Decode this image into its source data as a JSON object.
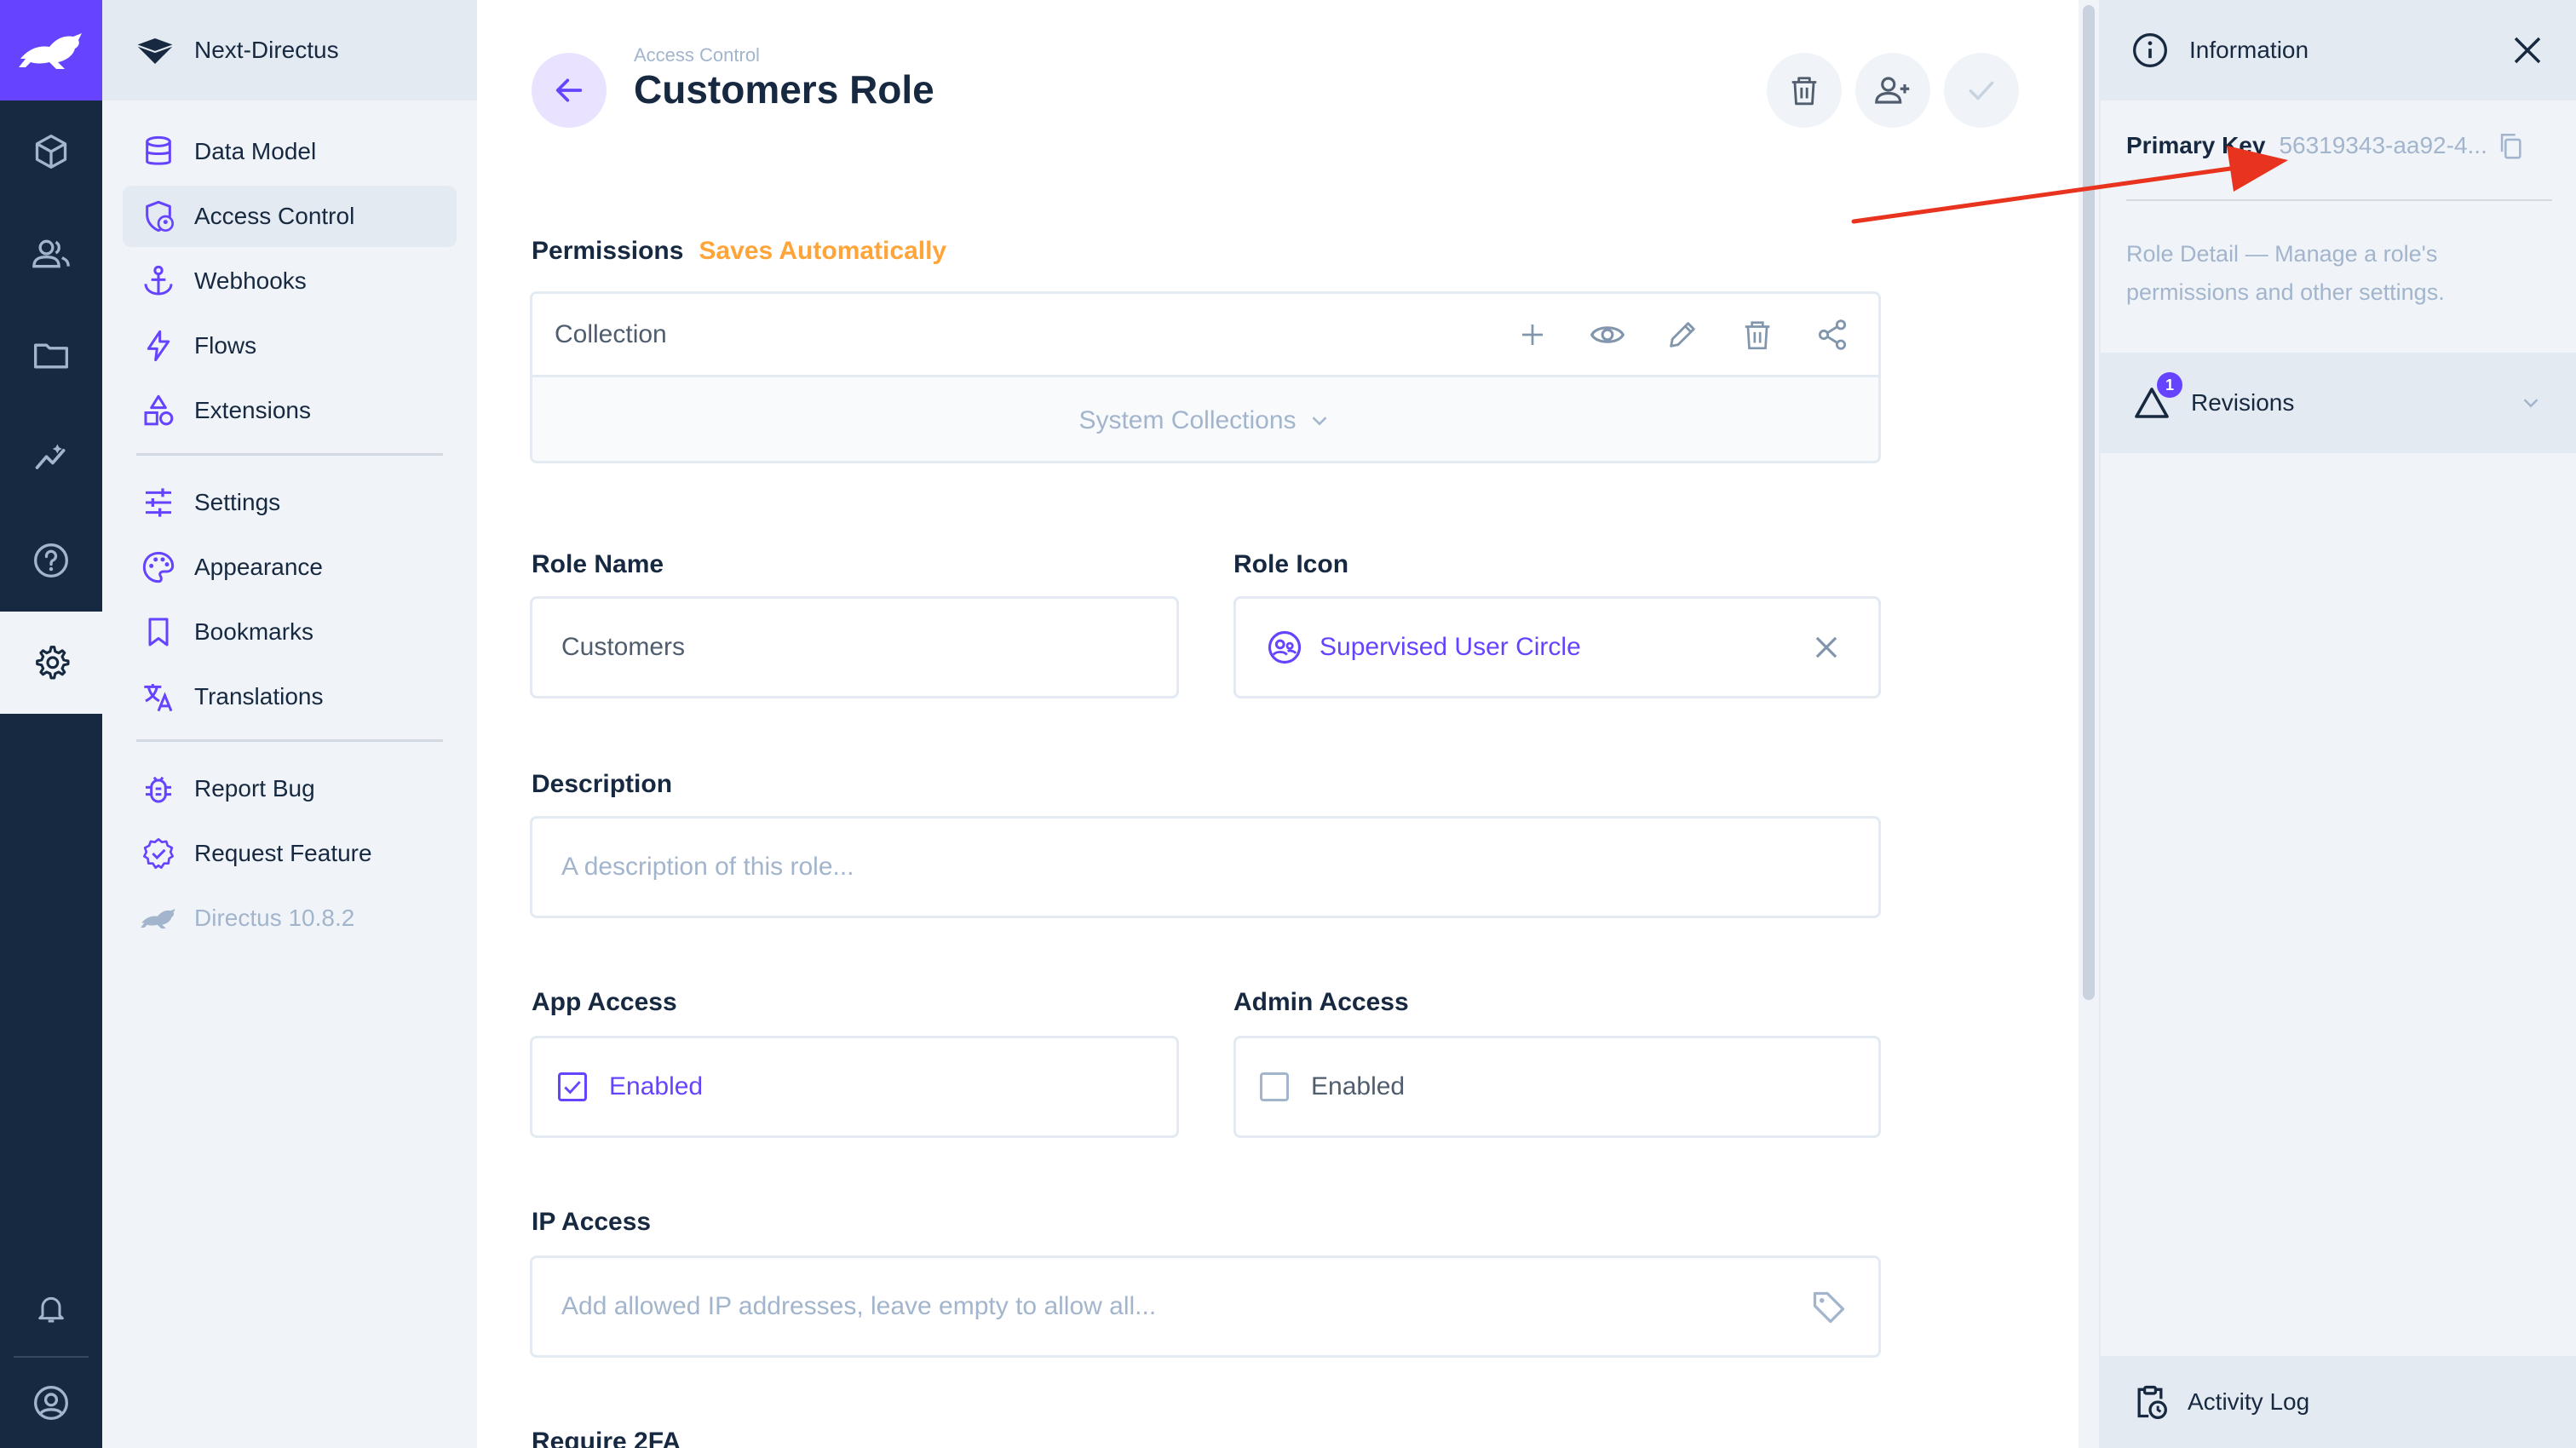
{
  "project": {
    "name": "Next-Directus"
  },
  "module_bar": {
    "items": [
      {
        "name": "content-module",
        "icon": "box-icon"
      },
      {
        "name": "users-module",
        "icon": "people-icon"
      },
      {
        "name": "files-module",
        "icon": "folder-icon"
      },
      {
        "name": "insights-module",
        "icon": "insights-icon"
      },
      {
        "name": "docs-module",
        "icon": "help-icon"
      },
      {
        "name": "settings-module",
        "icon": "gear-icon",
        "active": true
      }
    ],
    "bottom": [
      "bell-icon",
      "account-circle-icon"
    ]
  },
  "nav": {
    "items": [
      {
        "label": "Data Model",
        "icon": "database-icon"
      },
      {
        "label": "Access Control",
        "icon": "admin-shield-icon",
        "active": true
      },
      {
        "label": "Webhooks",
        "icon": "anchor-icon"
      },
      {
        "label": "Flows",
        "icon": "bolt-icon"
      },
      {
        "label": "Extensions",
        "icon": "category-icon"
      },
      {
        "label": "Settings",
        "icon": "tune-icon"
      },
      {
        "label": "Appearance",
        "icon": "palette-icon"
      },
      {
        "label": "Bookmarks",
        "icon": "bookmark-icon"
      },
      {
        "label": "Translations",
        "icon": "translate-icon"
      },
      {
        "label": "Report Bug",
        "icon": "bug-icon"
      },
      {
        "label": "Request Feature",
        "icon": "verified-icon"
      },
      {
        "label": "Directus 10.8.2",
        "icon": "directus-rabbit-icon"
      }
    ]
  },
  "header": {
    "breadcrumb": "Access Control",
    "title": "Customers Role",
    "actions": [
      "delete",
      "invite-user",
      "save"
    ]
  },
  "permissions": {
    "label": "Permissions",
    "note": "Saves Automatically",
    "column": "Collection",
    "system_collections": "System Collections"
  },
  "form": {
    "role_name": {
      "label": "Role Name",
      "value": "Customers"
    },
    "role_icon": {
      "label": "Role Icon",
      "value": "Supervised User Circle"
    },
    "description": {
      "label": "Description",
      "placeholder": "A description of this role..."
    },
    "app_access": {
      "label": "App Access",
      "option": "Enabled",
      "checked": true
    },
    "admin_access": {
      "label": "Admin Access",
      "option": "Enabled",
      "checked": false
    },
    "ip_access": {
      "label": "IP Access",
      "placeholder": "Add allowed IP addresses, leave empty to allow all..."
    },
    "require_2fa": {
      "label": "Require 2FA"
    }
  },
  "sidebar": {
    "title": "Information",
    "primary_key_label": "Primary Key",
    "primary_key_value": "56319343-aa92-4...",
    "role_detail_title": "Role Detail",
    "role_detail_text": " — Manage a role's permissions and other settings.",
    "revisions": "Revisions",
    "revisions_count": "1",
    "activity_log": "Activity Log"
  },
  "colors": {
    "accent": "#6644ff",
    "warning": "#ffa439",
    "dark": "#172940",
    "annotation_arrow": "#e8331f"
  }
}
